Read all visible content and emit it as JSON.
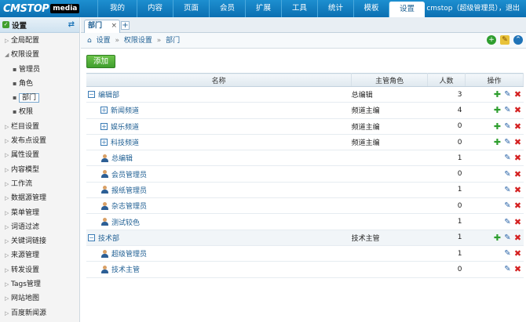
{
  "logo": {
    "text": "CMSTOP",
    "badge": "media"
  },
  "nav": {
    "items": [
      {
        "label": "我的"
      },
      {
        "label": "内容"
      },
      {
        "label": "页面"
      },
      {
        "label": "会员"
      },
      {
        "label": "扩展"
      },
      {
        "label": "工具"
      },
      {
        "label": "统计"
      },
      {
        "label": "模板"
      },
      {
        "label": "设置",
        "active": true
      }
    ],
    "user": "cmstop（超级管理员），退出"
  },
  "sidebar": {
    "title": "设置",
    "items": [
      {
        "label": "全局配置",
        "level": 0
      },
      {
        "label": "权限设置",
        "level": 0,
        "open": true
      },
      {
        "label": "管理员",
        "level": 1
      },
      {
        "label": "角色",
        "level": 1
      },
      {
        "label": "部门",
        "level": 1,
        "active": true
      },
      {
        "label": "权限",
        "level": 1
      },
      {
        "label": "栏目设置",
        "level": 0
      },
      {
        "label": "发布点设置",
        "level": 0
      },
      {
        "label": "属性设置",
        "level": 0
      },
      {
        "label": "内容模型",
        "level": 0
      },
      {
        "label": "工作流",
        "level": 0
      },
      {
        "label": "数据源管理",
        "level": 0
      },
      {
        "label": "菜单管理",
        "level": 0
      },
      {
        "label": "词语过滤",
        "level": 0
      },
      {
        "label": "关键词链接",
        "level": 0
      },
      {
        "label": "来源管理",
        "level": 0
      },
      {
        "label": "转发设置",
        "level": 0
      },
      {
        "label": "Tags管理",
        "level": 0
      },
      {
        "label": "网站地图",
        "level": 0
      },
      {
        "label": "百度新闻源",
        "level": 0
      }
    ]
  },
  "tabs": {
    "active": "部门",
    "close": "×",
    "add": "+"
  },
  "breadcrumb": {
    "items": [
      "设置",
      "权限设置",
      "部门"
    ],
    "sep": "»"
  },
  "toolbar": {
    "add_label": "添加"
  },
  "table": {
    "headers": {
      "name": "名称",
      "role": "主管角色",
      "count": "人数",
      "ops": "操作"
    },
    "rows": [
      {
        "name": "编辑部",
        "type": "dept",
        "level": 0,
        "toggle": "−",
        "role": "总编辑",
        "count": "3",
        "add": true
      },
      {
        "name": "新闻频道",
        "type": "dept",
        "level": 1,
        "toggle": "+",
        "role": "频道主编",
        "count": "4",
        "add": true
      },
      {
        "name": "娱乐频道",
        "type": "dept",
        "level": 1,
        "toggle": "+",
        "role": "频道主编",
        "count": "0",
        "add": true
      },
      {
        "name": "科技频道",
        "type": "dept",
        "level": 1,
        "toggle": "+",
        "role": "频道主编",
        "count": "0",
        "add": true
      },
      {
        "name": "总编辑",
        "type": "user",
        "level": 1,
        "role": "",
        "count": "1",
        "add": false
      },
      {
        "name": "会员管理员",
        "type": "user",
        "level": 1,
        "role": "",
        "count": "0",
        "add": false
      },
      {
        "name": "报纸管理员",
        "type": "user",
        "level": 1,
        "role": "",
        "count": "1",
        "add": false
      },
      {
        "name": "杂志管理员",
        "type": "user",
        "level": 1,
        "role": "",
        "count": "0",
        "add": false
      },
      {
        "name": "测试较色",
        "type": "user",
        "level": 1,
        "role": "",
        "count": "1",
        "add": false
      },
      {
        "name": "技术部",
        "type": "dept",
        "level": 0,
        "toggle": "−",
        "role": "技术主管",
        "count": "1",
        "add": true,
        "highlight": true
      },
      {
        "name": "超级管理员",
        "type": "user",
        "level": 1,
        "role": "",
        "count": "1",
        "add": false
      },
      {
        "name": "技术主管",
        "type": "user",
        "level": 1,
        "role": "",
        "count": "0",
        "add": false
      }
    ]
  },
  "colors": {
    "topbar": "#0b6fb1",
    "link": "#1f5f93",
    "add": "#2e9e2e",
    "delete": "#d42020"
  }
}
